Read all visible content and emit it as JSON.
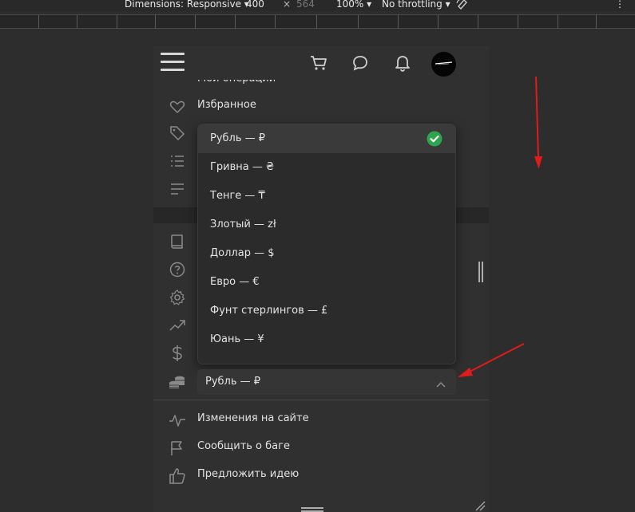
{
  "devtools": {
    "dimensions_label": "Dimensions: Responsive ▾",
    "width": "400",
    "times": "×",
    "height": "564",
    "zoom": "100% ▾",
    "throttling": "No throttling ▾",
    "more": "⋮"
  },
  "header": {
    "icons": [
      "menu-icon",
      "cart-icon",
      "chat-icon",
      "bell-icon"
    ]
  },
  "menu": {
    "partial_item": "Мои операции",
    "favorites": "Избранное"
  },
  "currency_dropdown": {
    "options": [
      {
        "label": "Рубль — ₽",
        "selected": true
      },
      {
        "label": "Гривна — ₴",
        "selected": false
      },
      {
        "label": "Тенге — ₸",
        "selected": false
      },
      {
        "label": "Злотый — zł",
        "selected": false
      },
      {
        "label": "Доллар — $",
        "selected": false
      },
      {
        "label": "Евро — €",
        "selected": false
      },
      {
        "label": "Фунт стерлингов — £",
        "selected": false
      },
      {
        "label": "Юань — ¥",
        "selected": false
      }
    ],
    "selected_value": "Рубль — ₽"
  },
  "footer_menu": {
    "changes": "Изменения на сайте",
    "report_bug": "Сообщить о баге",
    "suggest_idea": "Предложить идею"
  },
  "colors": {
    "check_green": "#2ea44f",
    "arrow_red": "#e01b1b",
    "panel_bg": "#303030"
  }
}
